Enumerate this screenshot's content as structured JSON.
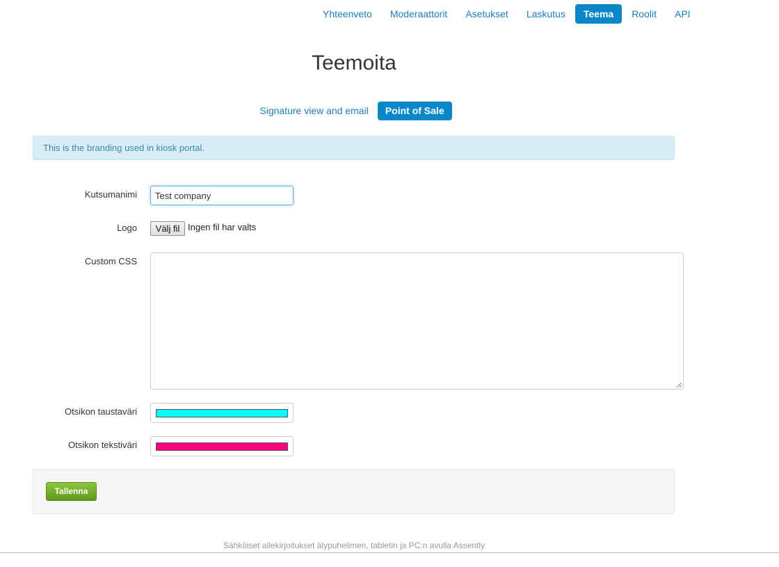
{
  "nav": {
    "items": [
      {
        "label": "Yhteenveto",
        "active": false
      },
      {
        "label": "Moderaattorit",
        "active": false
      },
      {
        "label": "Asetukset",
        "active": false
      },
      {
        "label": "Laskutus",
        "active": false
      },
      {
        "label": "Teema",
        "active": true
      },
      {
        "label": "Roolit",
        "active": false
      },
      {
        "label": "API",
        "active": false
      }
    ]
  },
  "page": {
    "title": "Teemoita"
  },
  "subtabs": [
    {
      "label": "Signature view and email",
      "active": false
    },
    {
      "label": "Point of Sale",
      "active": true
    }
  ],
  "alert": {
    "text": "This is the branding used in kiosk portal."
  },
  "form": {
    "name_label": "Kutsumanimi",
    "name_value": "Test company",
    "logo_label": "Logo",
    "logo_button": "Välj fil",
    "logo_status": "Ingen fil har valts",
    "css_label": "Custom CSS",
    "css_value": "",
    "header_bg_label": "Otsikon taustaväri",
    "header_bg_color": "#00ffff",
    "header_text_label": "Otsikon tekstiväri",
    "header_text_color": "#ff0080"
  },
  "actions": {
    "save_label": "Tallenna"
  },
  "footer": {
    "text": "Sähköiset allekirjoitukset älypuhelimen, tabletin ja PC:n avulla Assently"
  },
  "colors": {
    "accent": "#0b86c8",
    "link": "#1a7eb8",
    "save_button": "#72ae2a",
    "alert_bg": "#d9edf7"
  }
}
